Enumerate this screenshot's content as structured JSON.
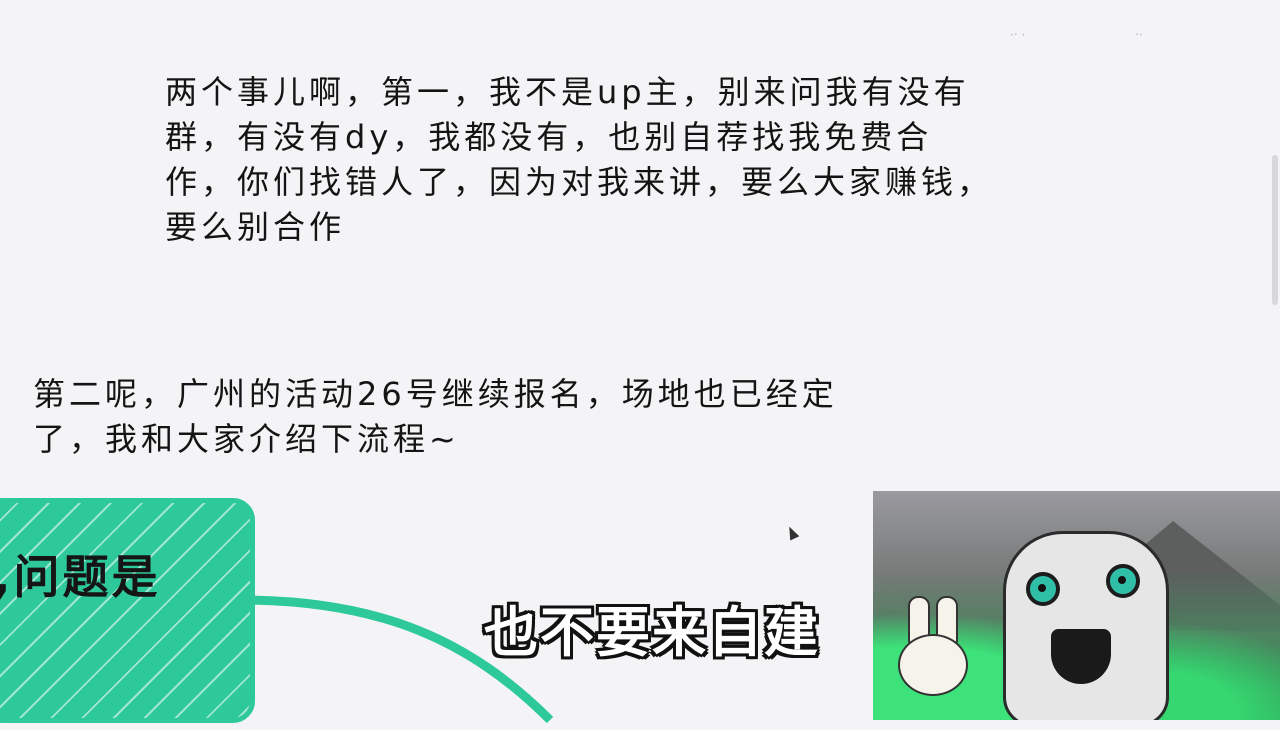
{
  "notes": {
    "first": [
      "两个事儿啊，第一，我不是up主，别来问我有没有",
      "群，有没有dy，我都没有，也别自荐找我免费合",
      "作，你们找错人了，因为对我来讲，要么大家赚钱，",
      "要么别合作"
    ],
    "second": [
      "第二呢，广州的活动26号继续报名，场地也已经定",
      "了，我和大家介绍下流程~"
    ]
  },
  "card": {
    "label": "问题是"
  },
  "subtitle": {
    "text": "也不要来自建"
  },
  "colors": {
    "accent_green": "#2ec99a",
    "background": "#f4f4f6"
  },
  "icons": {
    "cursor": "mouse-pointer-icon"
  }
}
